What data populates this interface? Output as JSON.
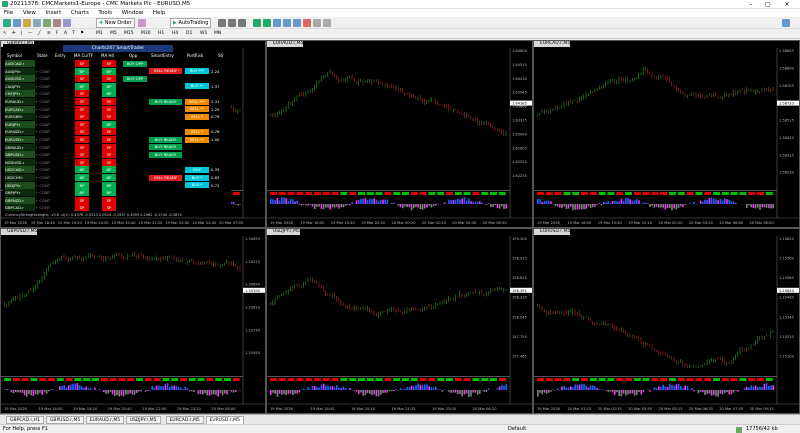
{
  "window": {
    "title": "20211378: CMCMarkets1-Europe - CMC Markets Plc - EURUSD,M5"
  },
  "menu": [
    "File",
    "View",
    "Insert",
    "Charts",
    "Tools",
    "Window",
    "Help"
  ],
  "toolbar": {
    "new_order": "New Order",
    "autotrading": "AutoTrading"
  },
  "timeframes": [
    "M1",
    "M5",
    "M15",
    "M30",
    "H1",
    "H4",
    "D1",
    "W1",
    "MN"
  ],
  "panel": {
    "title": "Charts247 SmartTrader",
    "headers": [
      "Symbol",
      "State",
      "Entry",
      "MA CurTF",
      "MA H4",
      "Opp",
      "SmartEntry",
      "PortRisk",
      "Str"
    ],
    "rows": [
      {
        "sym": "AUDCAD.r",
        "state": "",
        "ma1": "SP",
        "ma2": "SP",
        "opp": "BUY OPP",
        "se": "",
        "pr": "",
        "str": ""
      },
      {
        "sym": "AUDJPY.r",
        "state": "+ CONT",
        "ma1": "BP",
        "ma2": "BP",
        "opp": "",
        "se": "SELL READY",
        "pr": "BUY ***",
        "str": "2.24"
      },
      {
        "sym": "AUDUSD.r",
        "state": "+ CONT",
        "ma1": "SP",
        "ma2": "SP",
        "opp": "BUY OPP",
        "se": "",
        "pr": "",
        "str": ""
      },
      {
        "sym": "CADJPY.r",
        "state": "+ CONT",
        "ma1": "BP",
        "ma2": "BP",
        "opp": "",
        "se": "",
        "pr": "BUY **",
        "str": "1.37"
      },
      {
        "sym": "CHFJPY.r",
        "state": "+ CONT",
        "ma1": "SP",
        "ma2": "BP",
        "opp": "",
        "se": "",
        "pr": "",
        "str": ""
      },
      {
        "sym": "EURAUD.r",
        "state": "+ CONT",
        "ma1": "SP",
        "ma2": "SP",
        "opp": "",
        "se": "BUY READY",
        "pr": "SELL ***",
        "str": "2.31"
      },
      {
        "sym": "EURCAD.r",
        "state": "+ CONT",
        "ma1": "SP",
        "ma2": "SP",
        "opp": "",
        "se": "",
        "pr": "SELL **",
        "str": "1.25"
      },
      {
        "sym": "EURGBP.r",
        "state": "+ CONT",
        "ma1": "SP",
        "ma2": "SP",
        "opp": "",
        "se": "",
        "pr": "SELL *",
        "str": "0.79"
      },
      {
        "sym": "EURJPY.r",
        "state": "+ CONT",
        "ma1": "SP",
        "ma2": "BP",
        "opp": "",
        "se": "",
        "pr": "",
        "str": ""
      },
      {
        "sym": "EURNZD.r",
        "state": "+ CONT",
        "ma1": "SP",
        "ma2": "SP",
        "opp": "",
        "se": "",
        "pr": "SELL *",
        "str": "0.78"
      },
      {
        "sym": "EURUSD.r",
        "state": "+ CONT",
        "ma1": "SP",
        "ma2": "SP",
        "opp": "",
        "se": "BUY READY",
        "pr": "SELL **",
        "str": "1.00"
      },
      {
        "sym": "GBPAUD.r",
        "state": "+ CONT",
        "ma1": "SP",
        "ma2": "SP",
        "opp": "",
        "se": "BUY READY",
        "pr": "",
        "str": ""
      },
      {
        "sym": "GBPUSD.r",
        "state": "+ CONT",
        "ma1": "SP",
        "ma2": "SP",
        "opp": "",
        "se": "BUY READY",
        "pr": "",
        "str": ""
      },
      {
        "sym": "NZDUSD.r",
        "state": "+ CONT",
        "ma1": "SP",
        "ma2": "SP",
        "opp": "",
        "se": "",
        "pr": "",
        "str": ""
      },
      {
        "sym": "USDCAD.r",
        "state": "+ CONT",
        "ma1": "BP",
        "ma2": "BP",
        "opp": "",
        "se": "",
        "pr": "BUY",
        "str": "0.33"
      },
      {
        "sym": "USDCHF.r",
        "state": "+ CONT",
        "ma1": "BP",
        "ma2": "BP",
        "opp": "",
        "se": "SELL READY",
        "pr": "BUY *",
        "str": "0.83"
      },
      {
        "sym": "USDJPY.r",
        "state": "+ CONT",
        "ma1": "BP",
        "ma2": "BP",
        "opp": "",
        "se": "",
        "pr": "BUY *",
        "str": "0.72"
      },
      {
        "sym": "GBPJPY.r",
        "state": "+ CONT",
        "ma1": "BP",
        "ma2": "BP",
        "opp": "",
        "se": "",
        "pr": "",
        "str": ""
      },
      {
        "sym": "GBPNZD.r",
        "state": "+ CONT",
        "ma1": "SP",
        "ma2": "SP",
        "opp": "",
        "se": "",
        "pr": "",
        "str": ""
      },
      {
        "sym": "GBPCAD.r",
        "state": "+ CONT",
        "ma1": "SP",
        "ma2": "SP",
        "opp": "",
        "se": "",
        "pr": "",
        "str": ""
      }
    ]
  },
  "charts": [
    {
      "title": "GBPJPY.r,M5",
      "xt": [
        "19 Mar 2026",
        "19 Mar 18:40",
        "19 Mar 19:20",
        "19 Mar 20:00",
        "19 Mar 20:40",
        "19 Mar 21:20",
        "19 Mar 22:00",
        "19 Mar 22:40",
        "20 Mar 07:00"
      ]
    },
    {
      "title": "EURAUD.r,M5",
      "cur": "1.64185",
      "yt": [
        "1.64800",
        "1.64515",
        "1.64230",
        "1.63945",
        "1.63660",
        "1.63375",
        "1.63090",
        "1.62805",
        "1.62520",
        "1.62235"
      ],
      "xt": [
        "19 Mar 2026",
        "19 Mar 16:00",
        "19 Mar 19:20",
        "19 Mar 22:20",
        "20 Mar 00:20",
        "20 Mar 02:20",
        "20 Mar 04:30",
        "20 Mar 06:50"
      ]
    },
    {
      "title": "EURCAD.r,M5",
      "cur": "1.58733",
      "yt": [
        "1.58895",
        "1.58800",
        "1.58705",
        "1.58610",
        "1.58515",
        "1.58420",
        "1.58325",
        "1.58230"
      ],
      "xt": [
        "19 Mar 2026",
        "19 Mar 16:55",
        "19 Mar 19:30",
        "19 Mar 22:10",
        "20 Mar 00:20",
        "20 Mar 03:20",
        "20 Mar 06:00",
        "20 Mar 08:50"
      ]
    },
    {
      "title": "GBPUSD.r,M5",
      "cur": "1.34190",
      "yt": [
        "1.34450",
        "1.34270",
        "1.34090",
        "1.33910",
        "1.33730",
        "1.33550"
      ],
      "xt": [
        "19 Mar 2026",
        "19 Mar 18:00",
        "19 Mar 19:20",
        "19 Mar 20:40",
        "19 Mar 22:00",
        "19 Mar 23:20",
        "20 Mar 06:00"
      ]
    },
    {
      "title": "USDJPY.r,M5",
      "cur": "158.391",
      "yt": [
        "159.205",
        "158.915",
        "158.625",
        "158.335",
        "158.045",
        "157.755",
        "157.465"
      ],
      "xt": [
        "19 Mar 2026",
        "19 Mar 18:45",
        "19 Mar 20:10",
        "19 Mar 21:35",
        "19 Mar 23:00",
        "20 Mar 06:20"
      ]
    },
    {
      "title": "EURUSD.r,M5",
      "cur": "1.15640",
      "yt": [
        "1.15820",
        "1.15700",
        "1.15580",
        "1.15460",
        "1.15340",
        "1.15220",
        "1.15100"
      ],
      "xt": [
        "19 Mar 2026",
        "20 Mar 01:15",
        "20 Mar 02:35",
        "20 Mar 03:55",
        "20 Mar 05:15",
        "20 Mar 06:35",
        "20 Mar 07:55",
        "20 Mar 09:15"
      ]
    }
  ],
  "indicator_label": "CurrencyStrengthLength: -v3.6 -d(1): 0.4376 -0.5313 0.0524 -0.2937 0.4099 0.2962 -0.2740 -0.2874",
  "tabs": [
    "GBPCAD.r,H1",
    "GBPUSD.r,M5",
    "EURAUD.r,M5",
    "USDJPY.r,M5",
    "EURCAD.r,M5",
    "EURUSD.r,M5"
  ],
  "status": {
    "help": "For Help, press F1",
    "profile": "Default",
    "traffic": "17756/42 kb"
  },
  "colors": {
    "buy": "#00b050",
    "sell": "#e00000",
    "bg": "#000000",
    "wick": "#e8e800",
    "up": "#30c030",
    "down": "#e03030"
  }
}
